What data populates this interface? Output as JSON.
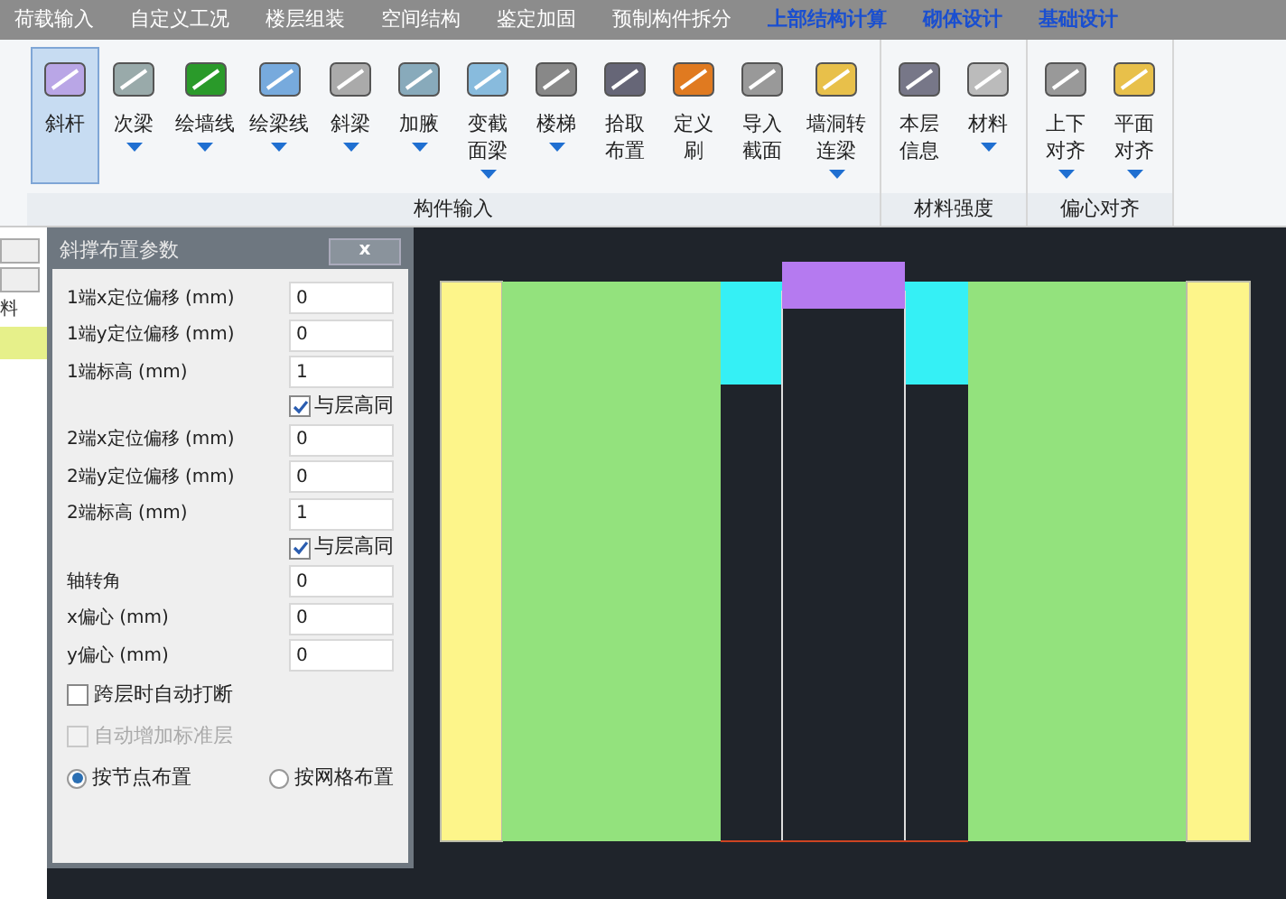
{
  "menu_tabs": [
    {
      "label": "荷载输入",
      "emphasis": false
    },
    {
      "label": "自定义工况",
      "emphasis": false
    },
    {
      "label": "楼层组装",
      "emphasis": false
    },
    {
      "label": "空间结构",
      "emphasis": false
    },
    {
      "label": "鉴定加固",
      "emphasis": false
    },
    {
      "label": "预制构件拆分",
      "emphasis": false
    },
    {
      "label": "上部结构计算",
      "emphasis": true
    },
    {
      "label": "砌体设计",
      "emphasis": true
    },
    {
      "label": "基础设计",
      "emphasis": true
    }
  ],
  "ribbon_groups": [
    {
      "title": "构件输入",
      "buttons": [
        {
          "label": "斜杆",
          "has_dropdown": false,
          "selected": true
        },
        {
          "label": "次梁",
          "has_dropdown": true,
          "selected": false
        },
        {
          "label": "绘墙线",
          "has_dropdown": true,
          "selected": false
        },
        {
          "label": "绘梁线",
          "has_dropdown": true,
          "selected": false
        },
        {
          "label": "斜梁",
          "has_dropdown": true,
          "selected": false
        },
        {
          "label": "加腋",
          "has_dropdown": true,
          "selected": false
        },
        {
          "label": "变截面梁",
          "has_dropdown": true,
          "selected": false
        },
        {
          "label": "楼梯",
          "has_dropdown": true,
          "selected": false
        },
        {
          "label": "拾取布置",
          "has_dropdown": false,
          "selected": false
        },
        {
          "label": "定义刷",
          "has_dropdown": false,
          "selected": false
        },
        {
          "label": "导入截面",
          "has_dropdown": false,
          "selected": false
        },
        {
          "label": "墙洞转连梁",
          "has_dropdown": true,
          "selected": false
        }
      ]
    },
    {
      "title": "材料强度",
      "buttons": [
        {
          "label": "本层信息",
          "has_dropdown": false,
          "selected": false
        },
        {
          "label": "材料",
          "has_dropdown": true,
          "selected": false
        }
      ]
    },
    {
      "title": "偏心对齐",
      "buttons": [
        {
          "label": "上下对齐",
          "has_dropdown": true,
          "selected": false
        },
        {
          "label": "平面对齐",
          "has_dropdown": true,
          "selected": false
        }
      ]
    }
  ],
  "side_panel": {
    "label": "料"
  },
  "dialog": {
    "title": "斜撑布置参数",
    "close": "x",
    "rows": [
      {
        "kind": "field",
        "label": "1端x定位偏移 (mm)",
        "value": "0"
      },
      {
        "kind": "field",
        "label": "1端y定位偏移 (mm)",
        "value": "0"
      },
      {
        "kind": "field",
        "label": "1端标高 (mm)",
        "value": "1"
      },
      {
        "kind": "check",
        "label": "与层高同",
        "checked": true,
        "disabled": false
      },
      {
        "kind": "field",
        "label": "2端x定位偏移 (mm)",
        "value": "0"
      },
      {
        "kind": "field",
        "label": "2端y定位偏移 (mm)",
        "value": "0"
      },
      {
        "kind": "field",
        "label": "2端标高 (mm)",
        "value": "1"
      },
      {
        "kind": "check",
        "label": "与层高同",
        "checked": true,
        "disabled": false
      },
      {
        "kind": "field",
        "label": "轴转角",
        "value": "0"
      },
      {
        "kind": "field",
        "label": "x偏心 (mm)",
        "value": "0"
      },
      {
        "kind": "field",
        "label": "y偏心 (mm)",
        "value": "0"
      },
      {
        "kind": "option",
        "label": "跨层时自动打断",
        "checked": false,
        "disabled": false
      },
      {
        "kind": "option",
        "label": "自动增加标准层",
        "checked": false,
        "disabled": true
      }
    ],
    "placement": [
      {
        "label": "按节点布置",
        "selected": true
      },
      {
        "label": "按网格布置",
        "selected": false
      }
    ]
  }
}
